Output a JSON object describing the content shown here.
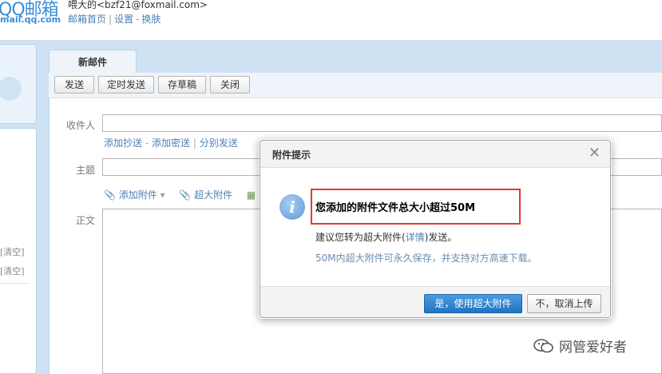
{
  "header": {
    "logo_main": "QQ邮箱",
    "logo_sub": "mail.qq.com",
    "user_line": "喂大的<bzf21@foxmail.com>",
    "links": [
      "邮箱首页",
      "设置",
      "换肤"
    ]
  },
  "sidebar": {
    "clear_labels": [
      "[清空]",
      "[清空]"
    ]
  },
  "compose": {
    "tab_label": "新邮件",
    "toolbar": [
      "发送",
      "定时发送",
      "存草稿",
      "关闭"
    ],
    "recipient_label": "收件人",
    "cc_links": [
      "添加抄送",
      "添加密送",
      "分别发送"
    ],
    "subject_label": "主题",
    "attach_label": "添加附件",
    "big_attach_label": "超大附件",
    "body_label": "正文"
  },
  "dialog": {
    "title": "附件提示",
    "message": "您添加的附件文件总大小超过50M",
    "suggest_prefix": "建议您转为超大附件(",
    "suggest_link": "详情",
    "suggest_suffix": ")发送。",
    "note": "50M内超大附件可永久保存，并支持对方高速下载。",
    "confirm_button": "是，使用超大附件",
    "cancel_button": "不，取消上传"
  },
  "watermark": "网管爱好者",
  "colors": {
    "accent": "#1f74c2",
    "link": "#4f7fb5",
    "highlight_border": "#e53935",
    "panel_bg": "#cfe2f3"
  }
}
